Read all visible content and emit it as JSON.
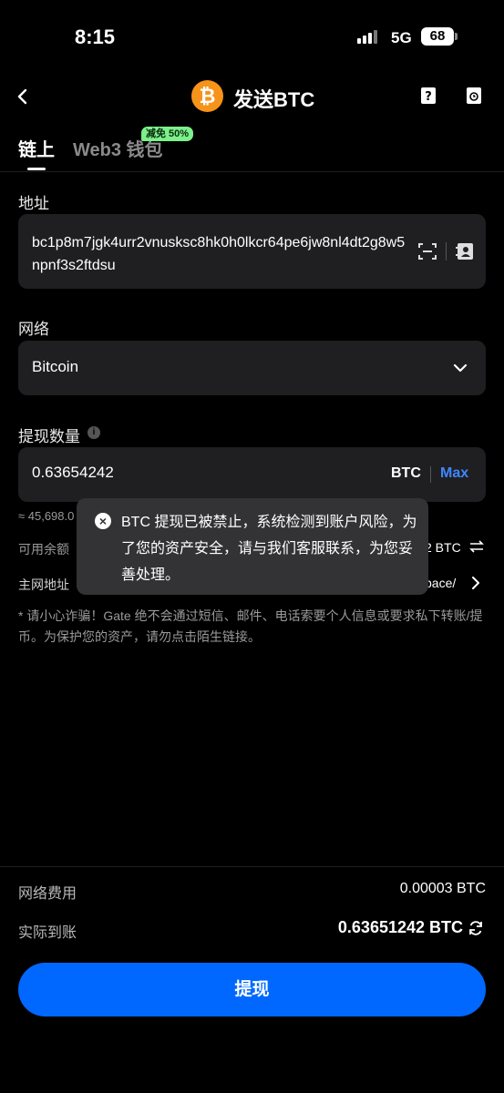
{
  "status_bar": {
    "time": "8:15",
    "network": "5G",
    "battery": "68"
  },
  "header": {
    "title": "发送BTC",
    "coin_symbol": "₿"
  },
  "tabs": [
    {
      "label": "链上",
      "active": true
    },
    {
      "label": "Web3 钱包",
      "badge": "减免 50%"
    }
  ],
  "address": {
    "label": "地址",
    "value": "bc1p8m7jgk4urr2vnusksc8hk0h0lkcr64pe6jw8nl4dt2g8w5npnf3s2ftdsu"
  },
  "network": {
    "label": "网络",
    "value": "Bitcoin"
  },
  "amount": {
    "label": "提现数量",
    "value": "0.63654242",
    "unit": "BTC",
    "max_label": "Max",
    "approx": "≈ 45,698.0"
  },
  "info_rows": {
    "available_label": "可用余额",
    "available_value": "2 BTC",
    "mainnet_label": "主网地址",
    "mainnet_value": "pace/"
  },
  "warning": "* 请小心诈骗！Gate 绝不会通过短信、邮件、电话索要个人信息或要求私下转账/提币。为保护您的资产，请勿点击陌生链接。",
  "toast": {
    "message": "BTC 提现已被禁止，系统检测到账户风险，为了您的资产安全，请与我们客服联系，为您妥善处理。"
  },
  "fee": {
    "label": "网络费用",
    "value": "0.00003 BTC"
  },
  "received": {
    "label": "实际到账",
    "value": "0.63651242 BTC"
  },
  "submit_label": "提现",
  "colors": {
    "accent": "#0068ff",
    "max_link": "#3e86ff",
    "btc_orange": "#F7931A",
    "badge": "#7cf08a"
  }
}
